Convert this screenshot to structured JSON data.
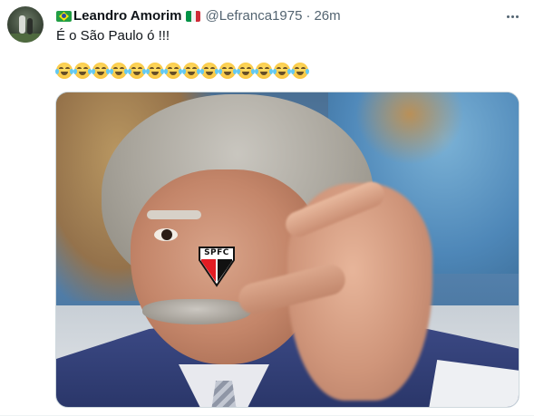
{
  "tweet": {
    "author": {
      "name": "Leandro Amorim",
      "handle": "@Lefranca1975",
      "name_prefix_flag": "brazil-flag-icon",
      "name_suffix_flag": "italy-flag-icon"
    },
    "separator": "·",
    "time": "26m",
    "text": "É o São Paulo ó !!!",
    "emoji_line": {
      "emoji": "face-with-tears-of-joy-icon",
      "count": 14
    },
    "media": {
      "shield_text": "SPFC"
    }
  },
  "colors": {
    "text_primary": "#0f1419",
    "text_secondary": "#536471",
    "border": "#cfd9de",
    "spfc_red": "#e21c23",
    "spfc_black": "#111111"
  }
}
